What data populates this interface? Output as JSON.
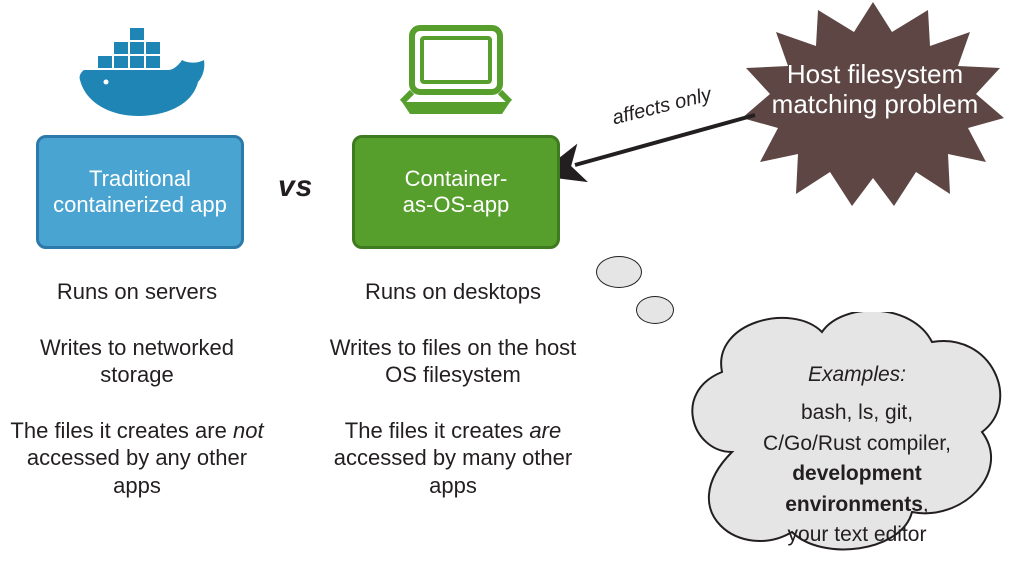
{
  "left": {
    "box": "Traditional containerized app",
    "b1": "Runs on servers",
    "b2": "Writes to networked storage",
    "b3a": "The files it creates are ",
    "b3not": "not",
    "b3b": " accessed by any other apps"
  },
  "vs": "vs",
  "right": {
    "box": "Container-\nas-OS-app",
    "b1": "Runs on desktops",
    "b2": "Writes to files on the host OS filesystem",
    "b3a": "The files it creates ",
    "b3are": "are",
    "b3b": " accessed by many other apps"
  },
  "starburst": "Host filesystem matching problem",
  "arrow_label": "affects only",
  "cloud": {
    "heading": "Examples:",
    "l1": "bash, ls, git,",
    "l2": "C/Go/Rust compiler,",
    "l3": "development environments",
    "l3_suffix": ",",
    "l4": "your text editor"
  },
  "colors": {
    "whale": "#1e85b4",
    "laptop": "#579f2c",
    "star": "#5d4644",
    "cloud_fill": "#e5e5e5"
  }
}
